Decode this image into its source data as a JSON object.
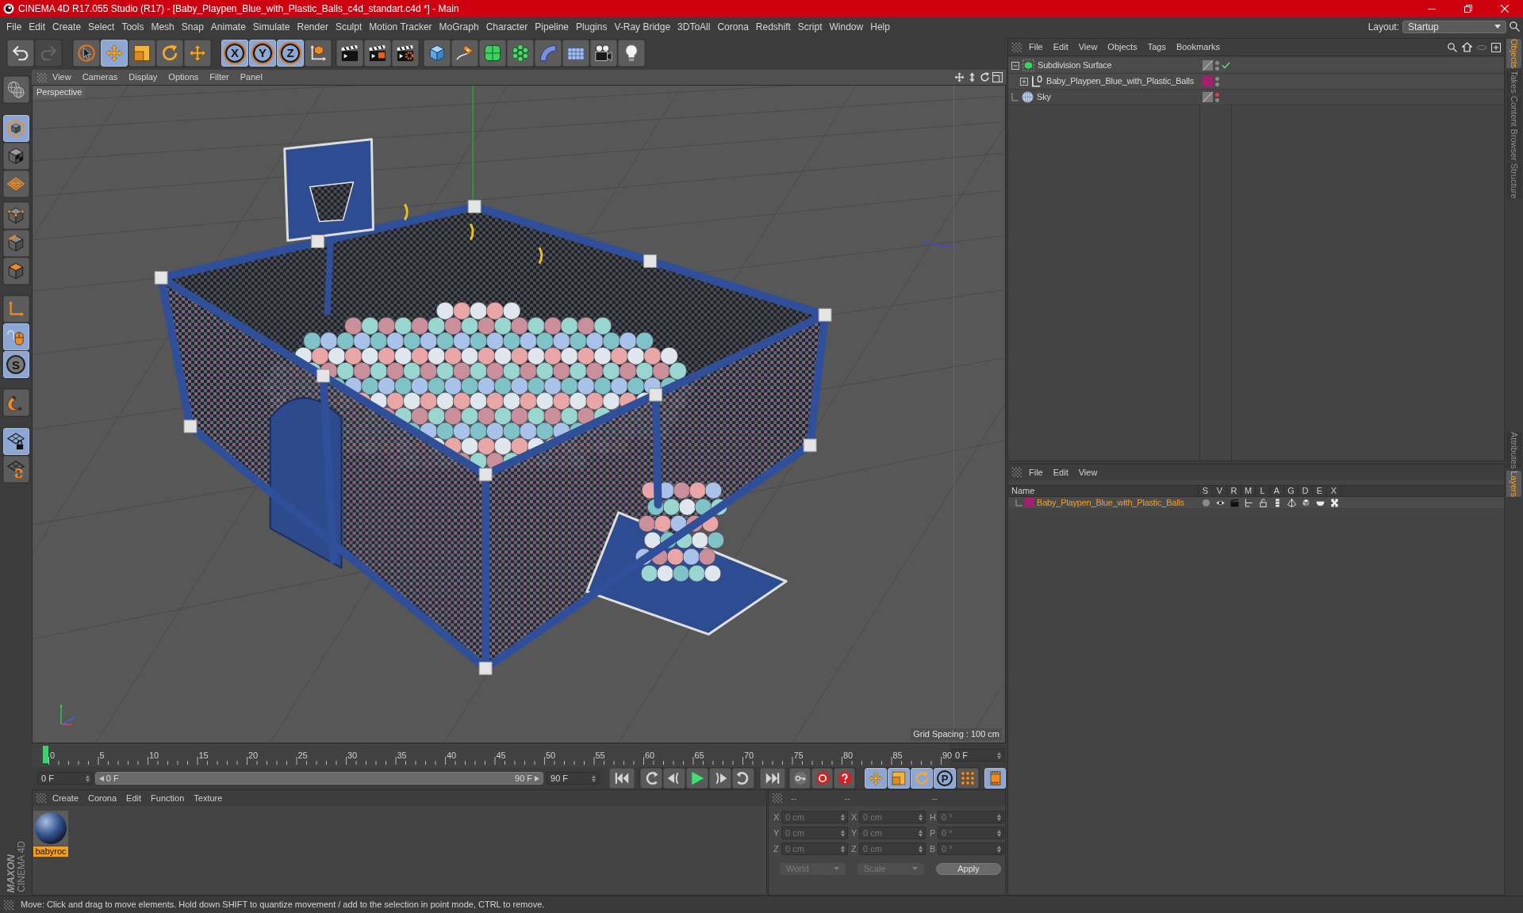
{
  "window": {
    "title": "CINEMA 4D R17.055 Studio (R17) - [Baby_Playpen_Blue_with_Plastic_Balls_c4d_standart.c4d *] - Main"
  },
  "menu_bar": [
    "File",
    "Edit",
    "Create",
    "Select",
    "Tools",
    "Mesh",
    "Snap",
    "Animate",
    "Simulate",
    "Render",
    "Sculpt",
    "Motion Tracker",
    "MoGraph",
    "Character",
    "Pipeline",
    "Plugins",
    "V-Ray Bridge",
    "3DToAll",
    "Corona",
    "Redshift",
    "Script",
    "Window",
    "Help"
  ],
  "layout": {
    "label": "Layout:",
    "value": "Startup"
  },
  "toolbar": [
    {
      "items": [
        {
          "active": false,
          "disabled": false
        },
        {
          "active": false,
          "disabled": true
        }
      ]
    },
    {
      "items": [
        {
          "active": false,
          "disabled": false
        },
        {
          "active": true,
          "disabled": false
        },
        {
          "active": false,
          "disabled": false
        },
        {
          "active": false,
          "disabled": false
        },
        {
          "active": false,
          "disabled": false
        }
      ]
    },
    {
      "items": [
        {
          "label": "X",
          "active": true,
          "disabled": false
        },
        {
          "label": "Y",
          "active": true,
          "disabled": false
        },
        {
          "label": "Z",
          "active": true,
          "disabled": false
        },
        {
          "active": false,
          "disabled": false
        }
      ]
    },
    {
      "items": [
        {
          "active": false,
          "disabled": false
        },
        {
          "active": false,
          "disabled": false
        },
        {
          "active": false,
          "disabled": false
        }
      ]
    },
    {
      "items": [
        {
          "active": false,
          "disabled": false
        },
        {
          "active": false,
          "disabled": false
        },
        {
          "active": false,
          "disabled": false
        },
        {
          "active": false,
          "disabled": false
        },
        {
          "active": false,
          "disabled": false
        },
        {
          "active": false,
          "disabled": false
        },
        {
          "active": false,
          "disabled": false
        },
        {
          "active": false,
          "disabled": false
        }
      ]
    }
  ],
  "left_toolbar": [
    {
      "items": [
        {
          "active": false
        }
      ]
    },
    {
      "items": [
        {
          "active": true
        },
        {
          "active": false
        },
        {
          "active": false
        }
      ]
    },
    {
      "items": [
        {
          "active": false
        },
        {
          "active": false
        },
        {
          "active": false
        }
      ]
    },
    {
      "items": [
        {
          "active": false
        },
        {
          "active": true
        },
        {
          "label": "S",
          "active": true
        }
      ]
    },
    {
      "items": [
        {
          "active": false
        }
      ]
    },
    {
      "items": [
        {
          "active": true
        },
        {
          "active": false
        }
      ]
    }
  ],
  "logo": {
    "brand": "MAXON",
    "product": "CINEMA 4D"
  },
  "viewport": {
    "menu": [
      "View",
      "Cameras",
      "Display",
      "Options",
      "Filter",
      "Panel"
    ],
    "camera": "Perspective",
    "grid_spacing": "Grid Spacing : 100 cm"
  },
  "timeline": {
    "ticks": [
      "0",
      "5",
      "10",
      "15",
      "20",
      "25",
      "30",
      "35",
      "40",
      "45",
      "50",
      "55",
      "60",
      "65",
      "70",
      "75",
      "80",
      "85",
      "90"
    ],
    "playhead": {
      "level": 0
    },
    "current_frame": "0 F"
  },
  "playback": {
    "start": "0 F",
    "range": {
      "start": "0 F",
      "end": "90 F",
      "level": 1
    },
    "end": "90 F",
    "key_modes": [
      {
        "active": true
      },
      {
        "active": true
      },
      {
        "active": true
      },
      {
        "label": "P",
        "active": true
      },
      {
        "active": false
      }
    ],
    "timeline_button": {
      "active": true
    }
  },
  "materials": {
    "menu": [
      "Create",
      "Corona",
      "Edit",
      "Function",
      "Texture"
    ],
    "items": [
      {
        "name": "babyroc",
        "selected": true
      }
    ]
  },
  "coordinates": {
    "headers": [
      "--",
      "--",
      "--"
    ],
    "rows": [
      {
        "position_axis": "X",
        "position": "0 cm",
        "size_axis": "X",
        "size": "0 cm",
        "rotation_axis": "H",
        "rotation": "0 °"
      },
      {
        "position_axis": "Y",
        "position": "0 cm",
        "size_axis": "Y",
        "size": "0 cm",
        "rotation_axis": "P",
        "rotation": "0 °"
      },
      {
        "position_axis": "Z",
        "position": "0 cm",
        "size_axis": "Z",
        "size": "0 cm",
        "rotation_axis": "B",
        "rotation": "0 °"
      }
    ],
    "space": "World",
    "size_mode": "Scale",
    "apply": "Apply"
  },
  "object_manager": {
    "menu": [
      "File",
      "Edit",
      "View",
      "Objects",
      "Tags",
      "Bookmarks"
    ],
    "objects": [
      {
        "name": "Subdivision Surface",
        "kind": "subdivision",
        "expanded": true,
        "editor_hidden": false,
        "render_hidden": false,
        "enabled": true,
        "children": [
          {
            "name": "Baby_Playpen_Blue_with_Plastic_Balls",
            "kind": "null",
            "expanded": false,
            "color": "#a3206f",
            "editor_hidden": false,
            "render_hidden": false
          }
        ]
      },
      {
        "name": "Sky",
        "kind": "sky",
        "editor_hidden": true,
        "render_hidden": false
      }
    ]
  },
  "layer_manager": {
    "menu": [
      "File",
      "Edit",
      "View"
    ],
    "columns": [
      "Name",
      "S",
      "V",
      "R",
      "M",
      "L",
      "A",
      "G",
      "D",
      "E",
      "X"
    ],
    "layers": [
      {
        "name": "Baby_Playpen_Blue_with_Plastic_Balls",
        "color": "#a3206f"
      }
    ]
  },
  "side_tabs": {
    "top": [
      {
        "label": "Objects",
        "selected": true
      },
      {
        "label": "Takes",
        "selected": false
      },
      {
        "label": "Content Browser",
        "selected": false
      },
      {
        "label": "Structure",
        "selected": false
      }
    ],
    "bottom": [
      {
        "label": "Attributes",
        "selected": false
      },
      {
        "label": "Layers",
        "selected": true
      }
    ]
  },
  "status_bar": "Move: Click and drag to move elements. Hold down SHIFT to quantize movement / add to the selection in point mode, CTRL to remove."
}
